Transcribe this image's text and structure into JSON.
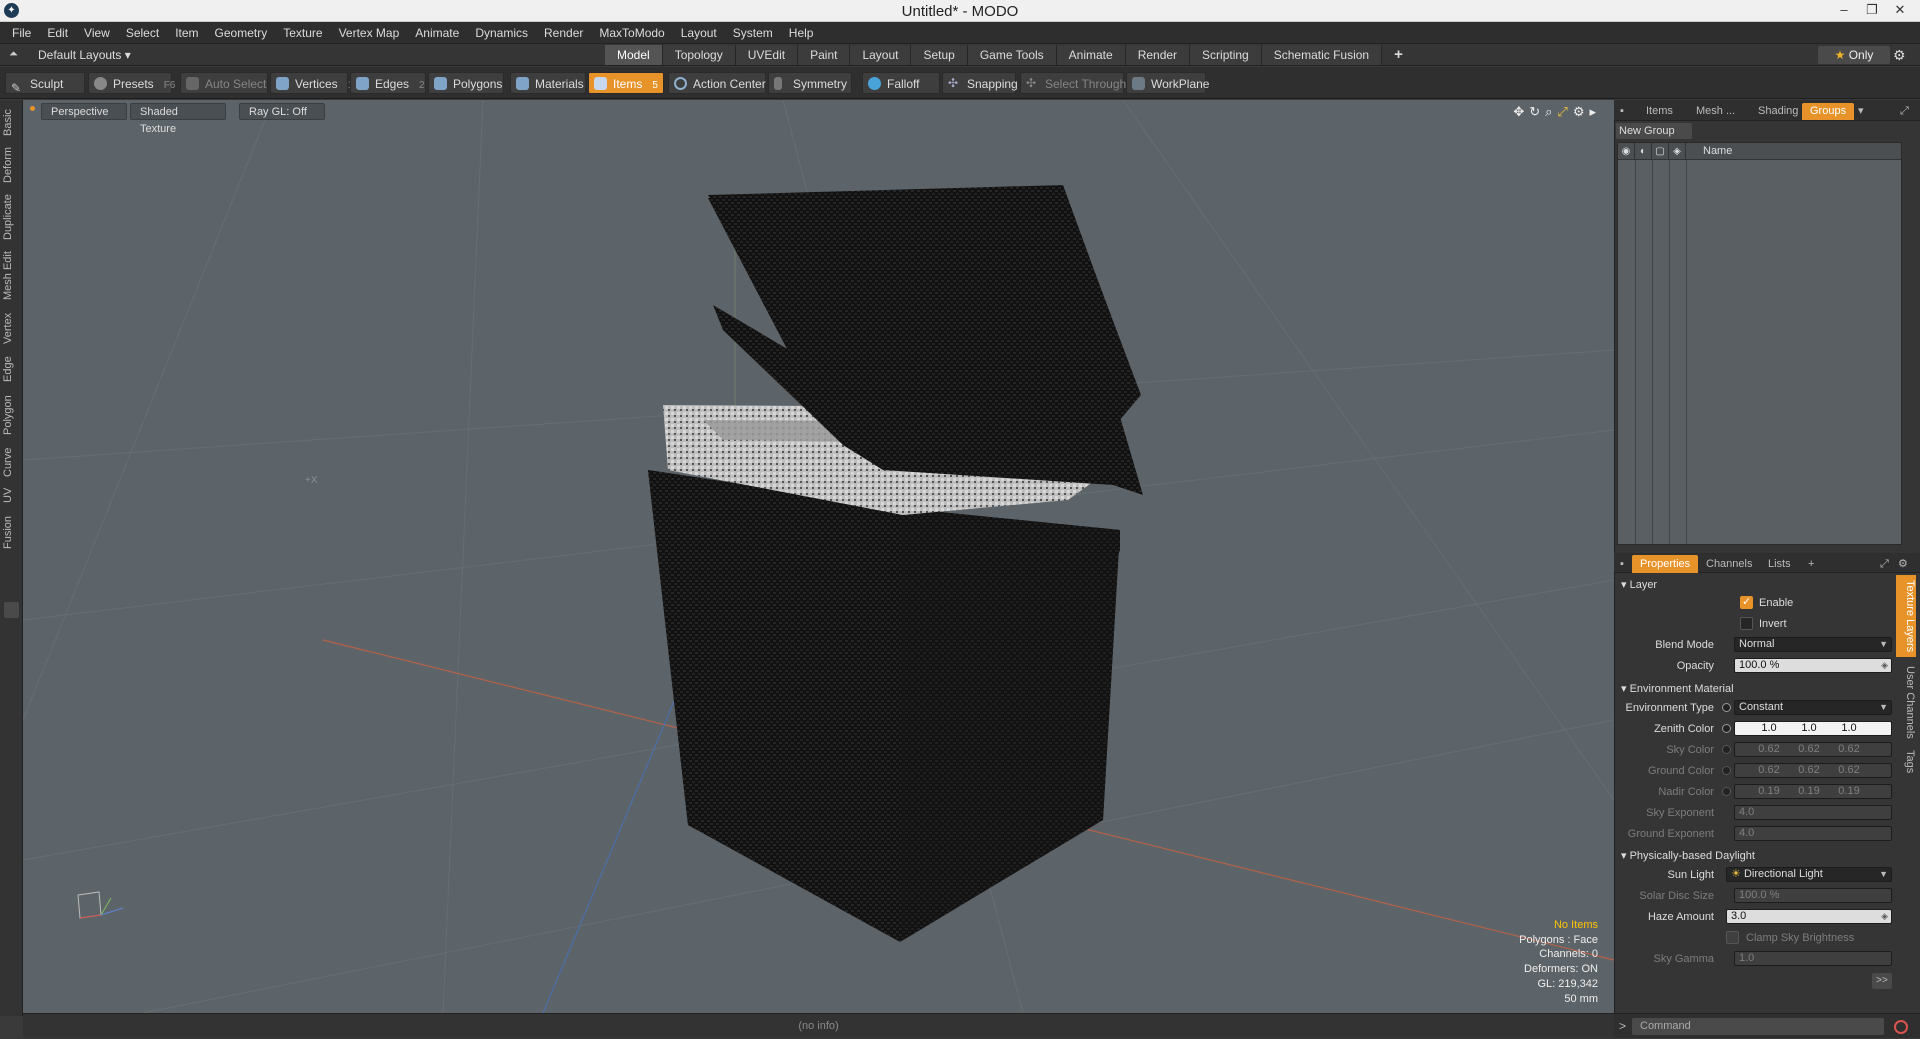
{
  "window": {
    "title": "Untitled* - MODO",
    "icon": "modo-logo-icon",
    "controls": [
      "–",
      "❐",
      "✕"
    ]
  },
  "menu": [
    "File",
    "Edit",
    "View",
    "Select",
    "Item",
    "Geometry",
    "Texture",
    "Vertex Map",
    "Animate",
    "Dynamics",
    "Render",
    "MaxToModo",
    "Layout",
    "System",
    "Help"
  ],
  "layoutbar": {
    "layout_name": "Default Layouts ▾",
    "tabs": [
      "Model",
      "Topology",
      "UVEdit",
      "Paint",
      "Layout",
      "Setup",
      "Game Tools",
      "Animate",
      "Render",
      "Scripting",
      "Schematic Fusion"
    ],
    "active_tab": "Model",
    "add_tab": "+",
    "only_label": "Only",
    "star": "★"
  },
  "toolbar": {
    "sculpt": "Sculpt",
    "presets": "Presets",
    "presets_key": "F6",
    "auto_select": "Auto Select",
    "vertices": "Vertices",
    "vertices_key": "1",
    "edges": "Edges",
    "edges_key": "2",
    "polygons": "Polygons",
    "materials": "Materials",
    "items": "Items",
    "items_key": "5",
    "action_center": "Action Center",
    "symmetry": "Symmetry",
    "falloff": "Falloff",
    "snapping": "Snapping",
    "select_through": "Select Through",
    "workplane": "WorkPlane",
    "accent": "#e8932a"
  },
  "left_tabs": [
    "Basic",
    "Deform",
    "Duplicate",
    "Mesh Edit",
    "Vertex",
    "Edge",
    "Polygon",
    "Curve",
    "UV",
    "Fusion"
  ],
  "viewport": {
    "view": "Perspective",
    "shading": "Shaded Texture",
    "raygl": "Ray GL: Off",
    "background": "#5d6469",
    "axis_label": "+X",
    "hud": {
      "items": "No Items",
      "polygons": "Polygons : Face",
      "channels": "Channels: 0",
      "deformers": "Deformers: ON",
      "gl": "GL: 219,342",
      "scale": "50 mm"
    }
  },
  "status": {
    "info": "(no info)"
  },
  "groups_panel": {
    "tabs": [
      "Items",
      "Mesh ...",
      "Shading",
      "Groups"
    ],
    "active": "Groups",
    "new_group": "New Group",
    "name_col": "Name"
  },
  "props_panel": {
    "tabs": [
      "Properties",
      "Channels",
      "Lists",
      "+"
    ],
    "active": "Properties",
    "layer_section": "Layer",
    "enable": "Enable",
    "invert": "Invert",
    "blend_mode_label": "Blend Mode",
    "blend_mode": "Normal",
    "opacity_label": "Opacity",
    "opacity": "100.0 %",
    "env_section": "Environment Material",
    "env_type_label": "Environment Type",
    "env_type": "Constant",
    "zenith_label": "Zenith Color",
    "zenith": [
      "1.0",
      "1.0",
      "1.0"
    ],
    "sky_label": "Sky Color",
    "sky": [
      "0.62",
      "0.62",
      "0.62"
    ],
    "ground_label": "Ground Color",
    "ground": [
      "0.62",
      "0.62",
      "0.62"
    ],
    "nadir_label": "Nadir Color",
    "nadir": [
      "0.19",
      "0.19",
      "0.19"
    ],
    "sky_exp_label": "Sky Exponent",
    "sky_exp": "4.0",
    "ground_exp_label": "Ground Exponent",
    "ground_exp": "4.0",
    "daylight_section": "Physically-based Daylight",
    "sun_light_label": "Sun Light",
    "sun_light": "Directional Light",
    "solar_disc_label": "Solar Disc Size",
    "solar_disc": "100.0 %",
    "haze_label": "Haze Amount",
    "haze": "3.0",
    "clamp_label": "Clamp Sky Brightness",
    "sky_gamma_label": "Sky Gamma",
    "sky_gamma": "1.0",
    "more": ">>"
  },
  "right_tabs": [
    "Texture Layers",
    "User Channels",
    "Tags"
  ],
  "command": {
    "placeholder": "Command",
    "prompt": ">"
  }
}
